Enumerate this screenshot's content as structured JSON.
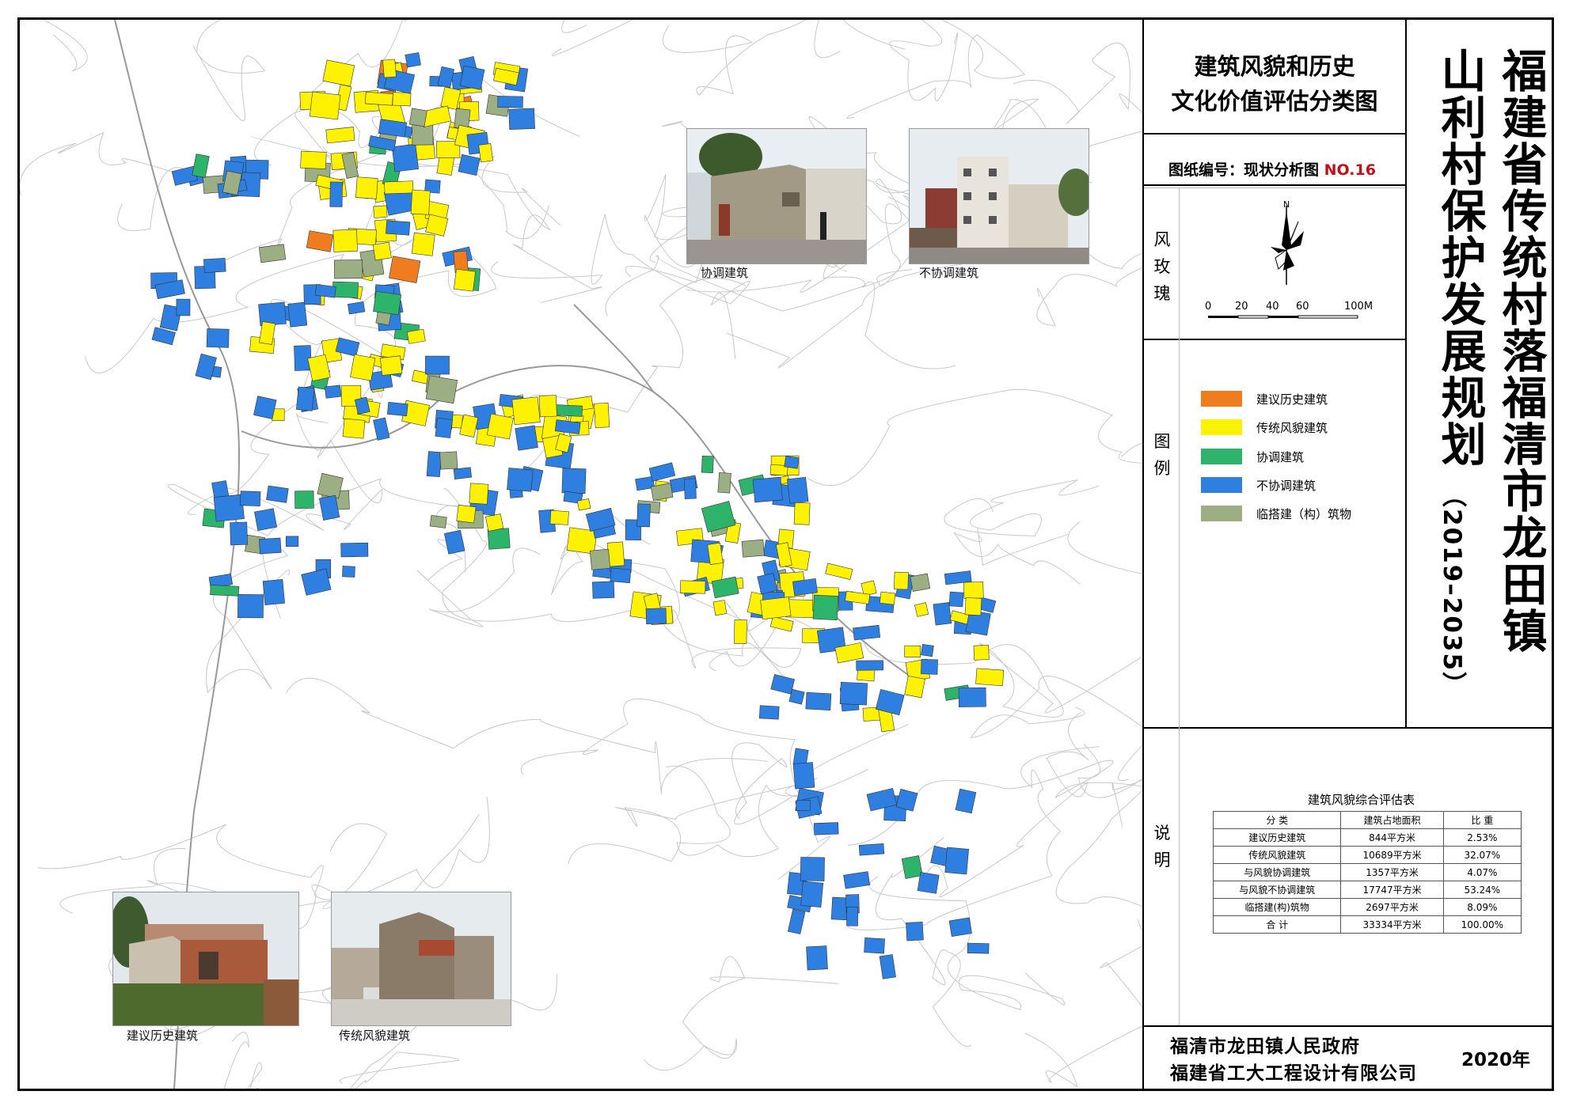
{
  "map_title": {
    "line1": "福建省传统村落福清市龙田镇",
    "line2": "山利村保护发展规划",
    "period": "（2019–2035）"
  },
  "panel": {
    "sheet_title_line1": "建筑风貌和历史",
    "sheet_title_line2": "文化价值评估分类图",
    "drawing_no_label": "图纸编号：现状分析图",
    "drawing_no_value": "NO.16",
    "section_wind_rose": "风玫瑰",
    "section_legend": "图例",
    "section_notes": "说明"
  },
  "scale_bar": {
    "north": "N",
    "labels": [
      "0",
      "20",
      "40",
      "60",
      "100M"
    ]
  },
  "legend": [
    {
      "label": "建议历史建筑",
      "color": "#ef7c1e"
    },
    {
      "label": "传统风貌建筑",
      "color": "#fff200"
    },
    {
      "label": "协调建筑",
      "color": "#2db36a"
    },
    {
      "label": "不协调建筑",
      "color": "#2e7fe0"
    },
    {
      "label": "临搭建（构）筑物",
      "color": "#9caf84"
    }
  ],
  "evaluation_table": {
    "title": "建筑风貌综合评估表",
    "headers": [
      "分 类",
      "建筑占地面积",
      "比 重"
    ],
    "rows": [
      [
        "建议历史建筑",
        "844平方米",
        "2.53%"
      ],
      [
        "传统风貌建筑",
        "10689平方米",
        "32.07%"
      ],
      [
        "与风貌协调建筑",
        "1357平方米",
        "4.07%"
      ],
      [
        "与风貌不协调建筑",
        "17747平方米",
        "53.24%"
      ],
      [
        "临搭建(构)筑物",
        "2697平方米",
        "8.09%"
      ],
      [
        "合 计",
        "33334平方米",
        "100.00%"
      ]
    ]
  },
  "photos": {
    "coordinated": "协调建筑",
    "uncoordinated": "不协调建筑",
    "historic": "建议历史建筑",
    "traditional": "传统风貌建筑"
  },
  "footer": {
    "org1": "福清市龙田镇人民政府",
    "org2": "福建省工大工程设计有限公司",
    "year": "2020年"
  },
  "map_colors": {
    "historic": "#ef7c1e",
    "traditional": "#fff200",
    "coordinated": "#2db36a",
    "uncoordinated": "#2e7fe0",
    "temporary": "#9caf84",
    "outline": "#333333",
    "contour": "#c8c8c8"
  }
}
